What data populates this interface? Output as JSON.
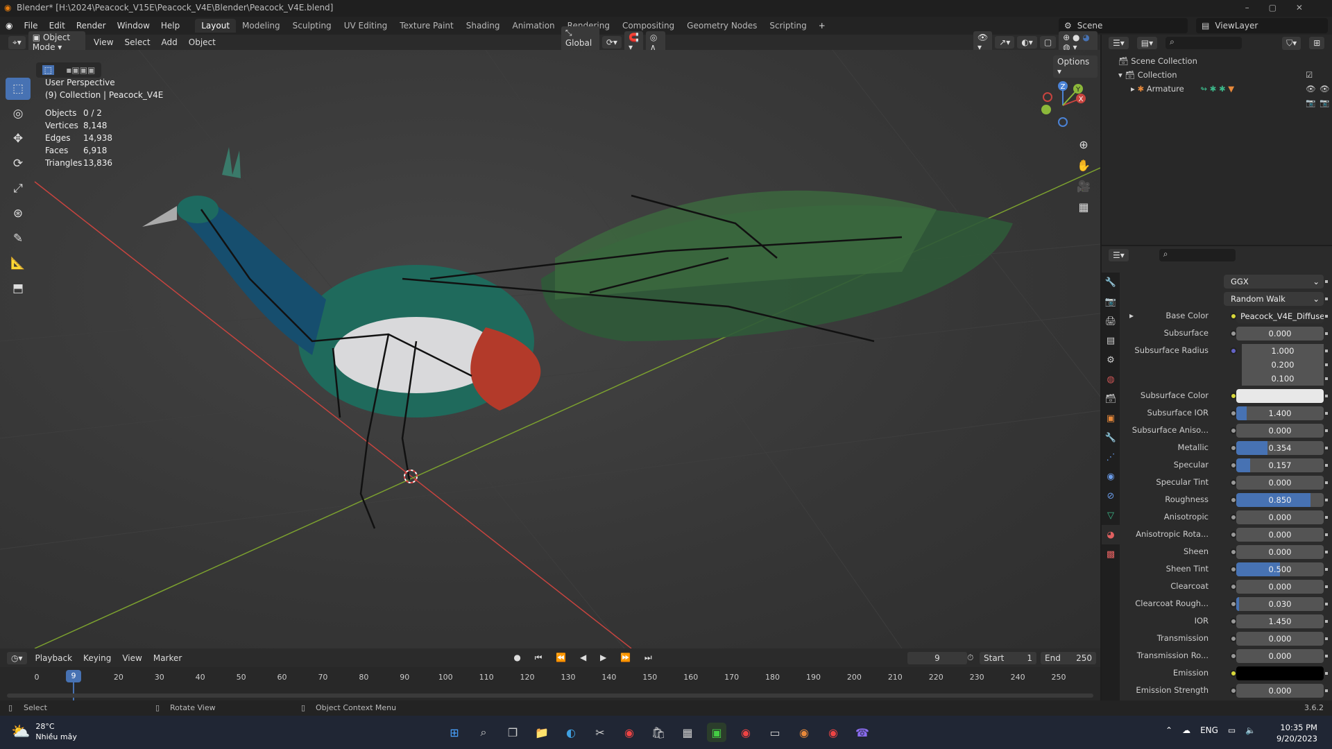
{
  "window": {
    "title": "Blender* [H:\\2024\\Peacock_V15E\\Peacock_V4E\\Blender\\Peacock_V4E.blend]"
  },
  "menu": [
    "File",
    "Edit",
    "Render",
    "Window",
    "Help"
  ],
  "workspaces": [
    "Layout",
    "Modeling",
    "Sculpting",
    "UV Editing",
    "Texture Paint",
    "Shading",
    "Animation",
    "Rendering",
    "Compositing",
    "Geometry Nodes",
    "Scripting"
  ],
  "active_workspace": "Layout",
  "scene": {
    "name": "Scene",
    "view_layer": "ViewLayer"
  },
  "viewport_header": {
    "mode": "Object Mode",
    "menus": [
      "View",
      "Select",
      "Add",
      "Object"
    ],
    "orientation": "Global",
    "options": "Options"
  },
  "viewport": {
    "perspective": "User Perspective",
    "collection": "(9) Collection | Peacock_V4E",
    "stats": [
      {
        "label": "Objects",
        "value": "0 / 2"
      },
      {
        "label": "Vertices",
        "value": "8,148"
      },
      {
        "label": "Edges",
        "value": "14,938"
      },
      {
        "label": "Faces",
        "value": "6,918"
      },
      {
        "label": "Triangles",
        "value": "13,836"
      }
    ],
    "gizmo": {
      "x": "X",
      "y": "Y",
      "z": "Z"
    }
  },
  "outliner": {
    "items": [
      {
        "label": "Scene Collection"
      },
      {
        "label": "Collection"
      },
      {
        "label": "Armature"
      }
    ]
  },
  "properties": {
    "rows": [
      {
        "type": "dropdown",
        "value": "GGX"
      },
      {
        "type": "dropdown",
        "value": "Random Walk"
      },
      {
        "type": "texture",
        "label": "Base Color",
        "value": "Peacock_V4E_Diffuse"
      },
      {
        "type": "number",
        "label": "Subsurface",
        "value": "0.000",
        "fill": 0
      },
      {
        "type": "vector",
        "label": "Subsurface Radius",
        "values": [
          "1.000",
          "0.200",
          "0.100"
        ]
      },
      {
        "type": "color",
        "label": "Subsurface Color",
        "color": "#e8e8e8"
      },
      {
        "type": "number",
        "label": "Subsurface IOR",
        "value": "1.400",
        "fill": 0.12
      },
      {
        "type": "number",
        "label": "Subsurface Aniso...",
        "value": "0.000",
        "fill": 0
      },
      {
        "type": "number",
        "label": "Metallic",
        "value": "0.354",
        "fill": 0.354
      },
      {
        "type": "number",
        "label": "Specular",
        "value": "0.157",
        "fill": 0.157
      },
      {
        "type": "number",
        "label": "Specular Tint",
        "value": "0.000",
        "fill": 0
      },
      {
        "type": "number",
        "label": "Roughness",
        "value": "0.850",
        "fill": 0.85
      },
      {
        "type": "number",
        "label": "Anisotropic",
        "value": "0.000",
        "fill": 0
      },
      {
        "type": "number",
        "label": "Anisotropic Rota...",
        "value": "0.000",
        "fill": 0
      },
      {
        "type": "number",
        "label": "Sheen",
        "value": "0.000",
        "fill": 0
      },
      {
        "type": "number",
        "label": "Sheen Tint",
        "value": "0.500",
        "fill": 0.5
      },
      {
        "type": "number",
        "label": "Clearcoat",
        "value": "0.000",
        "fill": 0
      },
      {
        "type": "number",
        "label": "Clearcoat Rough...",
        "value": "0.030",
        "fill": 0.03
      },
      {
        "type": "number",
        "label": "IOR",
        "value": "1.450",
        "fill": 0
      },
      {
        "type": "number",
        "label": "Transmission",
        "value": "0.000",
        "fill": 0
      },
      {
        "type": "number",
        "label": "Transmission Ro...",
        "value": "0.000",
        "fill": 0
      },
      {
        "type": "color",
        "label": "Emission",
        "color": "#000000"
      },
      {
        "type": "number",
        "label": "Emission Strength",
        "value": "0.000",
        "fill": 0
      }
    ]
  },
  "timeline": {
    "menus": [
      "Playback",
      "Keying",
      "View",
      "Marker"
    ],
    "current_frame": "9",
    "start_label": "Start",
    "start": "1",
    "end_label": "End",
    "end": "250",
    "ticks": [
      "0",
      "20",
      "30",
      "40",
      "50",
      "60",
      "70",
      "80",
      "90",
      "100",
      "110",
      "120",
      "130",
      "140",
      "150",
      "160",
      "170",
      "180",
      "190",
      "200",
      "210",
      "220",
      "230",
      "240",
      "250"
    ]
  },
  "statusbar": {
    "left": "Select",
    "middle": "Rotate View",
    "right": "Object Context Menu",
    "version": "3.6.2"
  },
  "taskbar": {
    "temp": "28°C",
    "weather": "Nhiều mây",
    "lang": "ENG",
    "time": "10:35 PM",
    "date": "9/20/2023"
  },
  "colors": {
    "accent": "#4772b3",
    "x_axis": "#c8443f",
    "y_axis": "#7ca12f"
  }
}
